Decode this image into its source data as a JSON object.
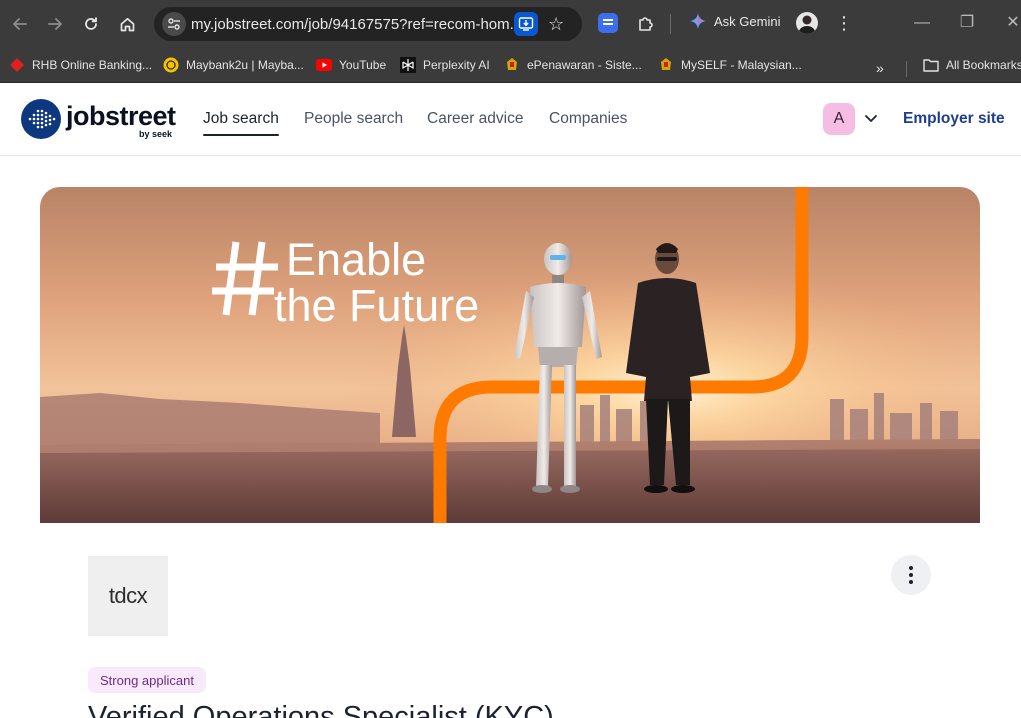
{
  "browser": {
    "url": "my.jobstreet.com/job/94167575?ref=recom-hom...",
    "gemini_label": "Ask Gemini",
    "bookmarks": [
      {
        "label": "RHB Online Banking...",
        "icon": "rhb-diamond-icon",
        "color": "#e0201b"
      },
      {
        "label": "Maybank2u | Mayba...",
        "icon": "maybank-tiger-icon",
        "color": "#f5c400"
      },
      {
        "label": "YouTube",
        "icon": "youtube-icon",
        "color": "#ff0000"
      },
      {
        "label": "Perplexity AI",
        "icon": "perplexity-icon",
        "color": "#ffffff"
      },
      {
        "label": "ePenawaran - Siste...",
        "icon": "jata-negara-icon",
        "color": "#d6a300"
      },
      {
        "label": "MySELF - Malaysian...",
        "icon": "jata-negara-icon",
        "color": "#d6a300"
      }
    ],
    "all_bookmarks_label": "All Bookmarks"
  },
  "site": {
    "logo_word": "jobstreet",
    "logo_sub": "by seek",
    "nav": [
      {
        "label": "Job search",
        "active": true
      },
      {
        "label": "People search",
        "active": false
      },
      {
        "label": "Career advice",
        "active": false
      },
      {
        "label": "Companies",
        "active": false
      }
    ],
    "avatar_initial": "A",
    "employer_link": "Employer site",
    "brand_color": "#0d3880"
  },
  "banner": {
    "headline_line1": "Enable",
    "headline_line2": "the Future",
    "accent_color": "#ff7a00"
  },
  "job": {
    "company_logo_text": "tdcx",
    "badge": "Strong applicant",
    "title": "Verified Operations Specialist (KYC)"
  }
}
